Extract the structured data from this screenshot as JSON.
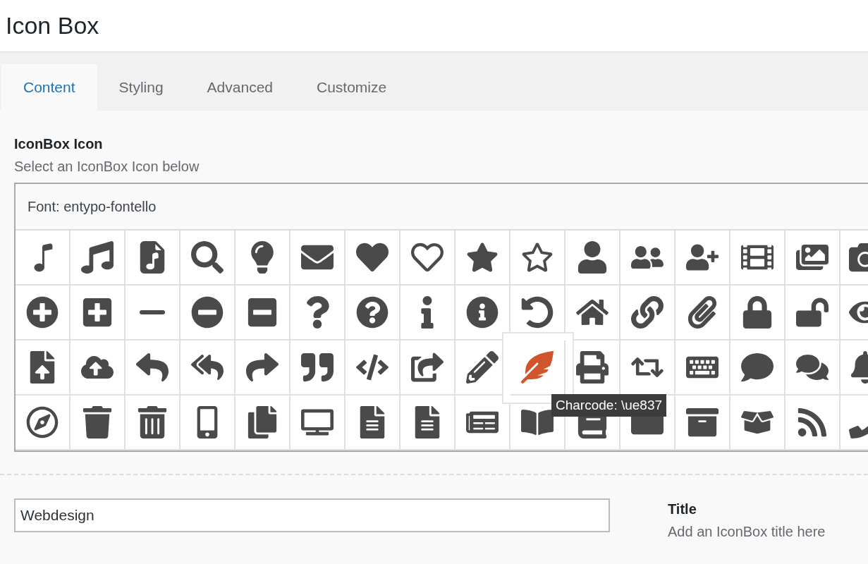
{
  "page_title": "Icon Box",
  "tabs": [
    {
      "label": "Content",
      "selected": true
    },
    {
      "label": "Styling",
      "selected": false
    },
    {
      "label": "Advanced",
      "selected": false
    },
    {
      "label": "Customize",
      "selected": false
    }
  ],
  "icon_field": {
    "label": "IconBox Icon",
    "description": "Select an IconBox Icon below",
    "font_label": "Font: entypo-fontello",
    "icons": [
      {
        "selected": false
      },
      {
        "selected": false
      },
      {
        "selected": false
      },
      {
        "selected": false
      },
      {
        "selected": false
      },
      {
        "selected": false
      },
      {
        "selected": false
      },
      {
        "selected": false
      },
      {
        "selected": false
      },
      {
        "selected": false
      },
      {
        "selected": false
      },
      {
        "selected": false
      },
      {
        "selected": false
      },
      {
        "selected": false
      },
      {
        "selected": false
      },
      {
        "selected": false
      },
      {
        "selected": false
      },
      {
        "selected": false
      },
      {
        "selected": false
      },
      {
        "selected": false
      },
      {
        "selected": false
      },
      {
        "selected": false
      },
      {
        "selected": false
      },
      {
        "selected": false
      },
      {
        "selected": false
      },
      {
        "selected": false
      },
      {
        "selected": false
      },
      {
        "selected": false
      },
      {
        "selected": false
      },
      {
        "selected": false
      },
      {
        "selected": false
      },
      {
        "selected": false
      },
      {
        "selected": false
      },
      {
        "selected": false
      },
      {
        "selected": false
      },
      {
        "selected": false
      },
      {
        "selected": false
      },
      {
        "selected": false
      },
      {
        "selected": false
      },
      {
        "selected": false
      },
      {
        "selected": false
      },
      {
        "selected": true
      },
      {
        "selected": false
      },
      {
        "selected": false
      },
      {
        "selected": false
      },
      {
        "selected": false
      },
      {
        "selected": false
      },
      {
        "selected": false
      },
      {
        "selected": false
      },
      {
        "selected": false
      },
      {
        "selected": false
      },
      {
        "selected": false
      },
      {
        "selected": false
      },
      {
        "selected": false
      },
      {
        "selected": false
      },
      {
        "selected": false
      },
      {
        "selected": false
      },
      {
        "selected": false
      },
      {
        "selected": false
      },
      {
        "selected": false
      },
      {
        "selected": false
      },
      {
        "selected": false
      },
      {
        "selected": false
      },
      {
        "selected": false
      }
    ],
    "tooltip": "Charcode: \\ue837"
  },
  "title_field": {
    "value": "Webdesign",
    "label": "Title",
    "description": "Add an IconBox title here"
  }
}
